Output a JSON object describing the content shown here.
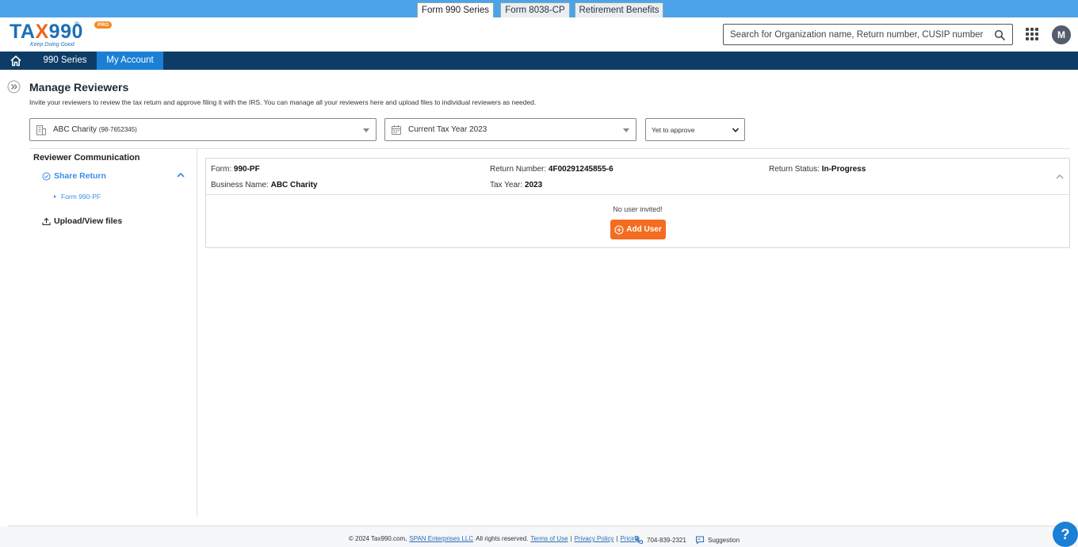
{
  "product_tabs": [
    {
      "label": "Form 990 Series",
      "active": true
    },
    {
      "label": "Form 8038-CP",
      "active": false
    },
    {
      "label": "Retirement Benefits",
      "active": false
    }
  ],
  "logo": {
    "text_a": "TA",
    "text_x": "X",
    "text_b": "990",
    "reg": "®",
    "badge": "PRO",
    "tagline": "Keep Doing Good"
  },
  "search": {
    "placeholder": "Search for Organization name, Return number, CUSIP number"
  },
  "user": {
    "avatar_initial": "M"
  },
  "nav": {
    "items": [
      {
        "label": "990 Series"
      },
      {
        "label": "My Account"
      }
    ],
    "active": "My Account"
  },
  "page": {
    "title": "Manage Reviewers",
    "description": "Invite your reviewers to review the tax return and approve filing it with the IRS. You can manage all your reviewers here and upload files to individual reviewers as needed."
  },
  "filters": {
    "organization": "ABC Charity",
    "ein": "(98-7652345)",
    "tax_year": "Current Tax Year 2023",
    "approval_status": "Yet to approve"
  },
  "sidebar": {
    "heading": "Reviewer Communication",
    "share_return": "Share Return",
    "form_link": "Form 990-PF",
    "upload": "Upload/View files"
  },
  "return_card": {
    "form_label": "Form:",
    "form_value": "990-PF",
    "return_number_label": "Return Number:",
    "return_number_value": "4F00291245855-6",
    "status_label": "Return Status:",
    "status_value": "In-Progress",
    "business_label": "Business Name:",
    "business_value": "ABC Charity",
    "tax_year_label": "Tax Year:",
    "tax_year_value": "2023",
    "empty_message": "No user invited!",
    "add_user_label": "Add User"
  },
  "footer": {
    "copyright": "© 2024 Tax990.com,",
    "company_link": "SPAN Enterprises LLC",
    "rights": "All rights reserved.",
    "terms": "Terms of Use",
    "privacy": "Privacy Policy",
    "pricing": "Pricing",
    "phone": "704-839-2321",
    "suggestion": "Suggestion",
    "sep": "|"
  },
  "help": {
    "label": "?"
  },
  "colors": {
    "accent_blue": "#1b7fd6",
    "nav_dark": "#0d3d66",
    "orange": "#f46c20",
    "link_blue": "#3b8ee8"
  }
}
